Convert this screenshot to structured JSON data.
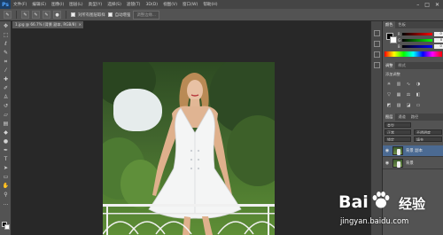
{
  "app": {
    "logo": "Ps"
  },
  "menu": [
    "文件(F)",
    "编辑(E)",
    "图像(I)",
    "图层(L)",
    "类型(Y)",
    "选择(S)",
    "滤镜(T)",
    "3D(D)",
    "视图(V)",
    "窗口(W)",
    "帮助(H)"
  ],
  "window_controls": {
    "minimize": "–",
    "maximize": "□",
    "close": "✕"
  },
  "options_bar": {
    "sample_all_layers": "对所有图层取样",
    "auto_enhance": "自动增强",
    "refine_edge": "调整边缘..."
  },
  "document": {
    "tab_title": "1.jpg @ 66.7% (背景 副本, RGB/8)",
    "tab_close": "×"
  },
  "panels": {
    "color_tabs": [
      "颜色",
      "色板"
    ],
    "color": {
      "r_label": "R",
      "g_label": "G",
      "b_label": "B",
      "r": "0",
      "g": "0",
      "b": "0"
    },
    "adjustment_tabs": [
      "调整",
      "样式"
    ],
    "adjustment_title": "添加调整",
    "layers_tabs": [
      "图层",
      "通道",
      "路径"
    ],
    "layers_kind": "类型",
    "layers_blend": "正常",
    "layers_opacity": "不透明度",
    "layers_lock": "锁定",
    "layers_fill": "填充",
    "layers": [
      {
        "name": "背景 副本",
        "selected": true
      },
      {
        "name": "背景",
        "selected": false
      }
    ]
  },
  "watermark": {
    "brand": "Bai",
    "brand2": "经验",
    "url": "jingyan.baidu.com"
  },
  "colors": {
    "accent": "#4b6a92",
    "app_bg": "#282828",
    "panel": "#535353"
  }
}
